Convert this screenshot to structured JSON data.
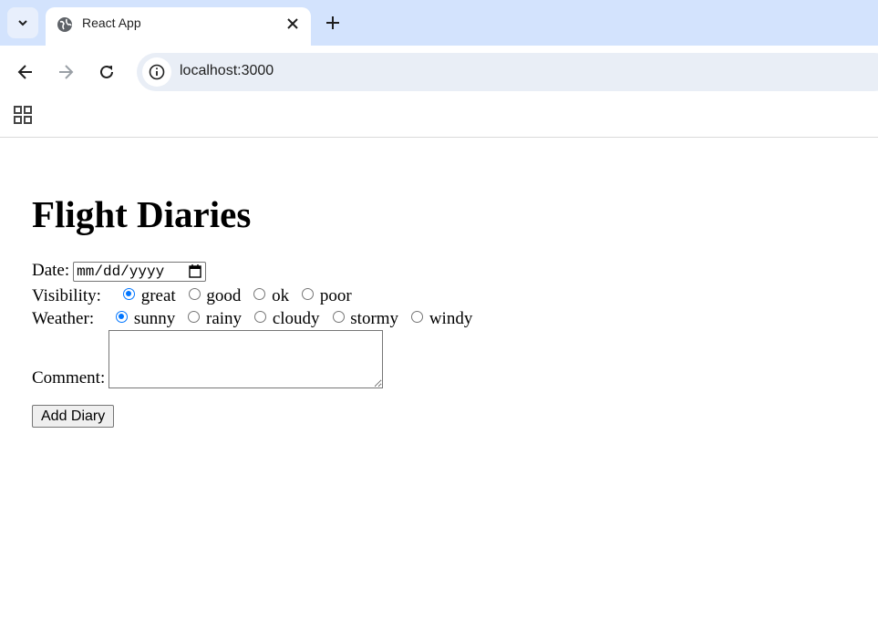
{
  "browser": {
    "tab_title": "React App",
    "url": "localhost:3000"
  },
  "page": {
    "heading": "Flight Diaries",
    "date": {
      "label": "Date:",
      "placeholder": "mm/dd/yyyy"
    },
    "visibility": {
      "label": "Visibility:",
      "options": [
        "great",
        "good",
        "ok",
        "poor"
      ],
      "selected": "great"
    },
    "weather": {
      "label": "Weather:",
      "options": [
        "sunny",
        "rainy",
        "cloudy",
        "stormy",
        "windy"
      ],
      "selected": "sunny"
    },
    "comment": {
      "label": "Comment:",
      "value": ""
    },
    "submit_label": "Add Diary"
  },
  "colors": {
    "accent": "#0075ff",
    "tabstrip": "#d3e3fd",
    "omnibox": "#e9eef6"
  },
  "icons": [
    "chevron-down-icon",
    "globe-icon",
    "close-icon",
    "plus-icon",
    "back-arrow-icon",
    "forward-arrow-icon",
    "reload-icon",
    "info-icon",
    "apps-grid-icon",
    "calendar-icon"
  ]
}
